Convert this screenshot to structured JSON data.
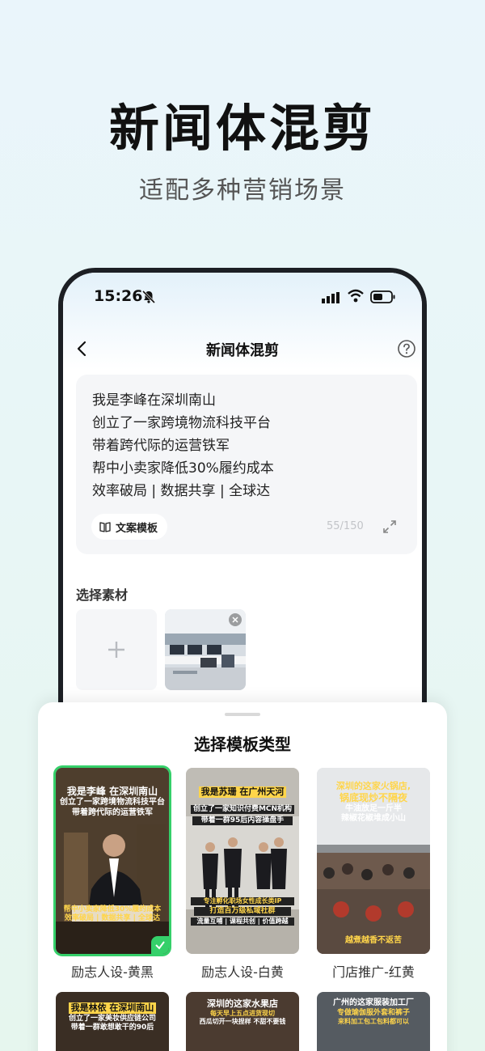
{
  "hero": {
    "title": "新闻体混剪",
    "subtitle": "适配多种营销场景"
  },
  "status_bar": {
    "time": "15:26"
  },
  "nav": {
    "title": "新闻体混剪"
  },
  "script_card": {
    "lines": [
      "我是李峰在深圳南山",
      "创立了一家跨境物流科技平台",
      "带着跨代际的运营铁军",
      "帮中小卖家降低30%履约成本",
      "效率破局 | 数据共享 | 全球达"
    ],
    "template_button": "文案模板",
    "char_count": "55/150"
  },
  "materials": {
    "title": "选择素材"
  },
  "sheet": {
    "title": "选择模板类型",
    "templates": [
      {
        "label": "励志人设-黄黑",
        "top_lines": [
          "我是李峰 在深圳南山",
          "创立了一家跨境物流科技平台",
          "带着跨代际的运营铁军"
        ],
        "bottom_lines": [
          "帮中小卖家降低30%履约成本",
          "效率破局 | 数据共享 | 全球达"
        ],
        "selected": true
      },
      {
        "label": "励志人设-白黄",
        "top_lines": [
          "我是苏珊 在广州天河",
          "创立了一家知识付费MCN机构",
          "带着一群95后内容操盘手"
        ],
        "bottom_lines": [
          "专注孵化职场女性成长类IP",
          "打造百万级私域社群",
          "流量互哺 | 课程共创 | 价值跨越"
        ],
        "selected": false
      },
      {
        "label": "门店推广-红黄",
        "top_lines": [
          "深圳的这家火锅店,",
          "锅底现炒不隔夜",
          "牛油放足一斤半",
          "辣椒花椒堆成小山"
        ],
        "bottom_lines": [
          "越煮越香不返苦"
        ],
        "selected": false
      }
    ],
    "row2": [
      {
        "lines": [
          "我是林依 在深圳南山",
          "创立了一家美妆供应链公司",
          "带着一群敢想敢干的90后"
        ]
      },
      {
        "lines": [
          "深圳的这家水果店",
          "每天早上五点进货现切",
          "西瓜切开一块捏样 不甜不要钱"
        ]
      },
      {
        "lines": [
          "广州的这家服装加工厂",
          "专做瑜伽服外套和裤子",
          "来料加工包工包料都可以"
        ]
      }
    ]
  },
  "colors": {
    "accent_green": "#35d06a",
    "overlay_yellow": "#ffd54a"
  }
}
